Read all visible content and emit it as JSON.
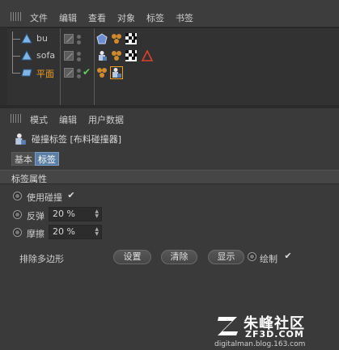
{
  "menubar": {
    "items": [
      "文件",
      "编辑",
      "查看",
      "对象",
      "标签",
      "书签"
    ]
  },
  "objects": [
    {
      "name": "bu",
      "icon": "mesh-icon",
      "selected": false,
      "tags": [
        "phong-tag-icon",
        "material-tag-icon",
        "texture-tag-icon"
      ],
      "extra": "compact-tag-icon"
    },
    {
      "name": "sofa",
      "icon": "mesh-icon",
      "selected": false,
      "tags": [
        "cloth-tag-icon",
        "material-tag-icon",
        "texture-tag-icon",
        "warning-icon"
      ],
      "extra": ""
    },
    {
      "name": "平面",
      "icon": "plane-icon",
      "selected": true,
      "tags": [
        "material-tag-icon",
        "collider-tag-icon"
      ],
      "extra": ""
    }
  ],
  "attributes": {
    "menu": [
      "模式",
      "编辑",
      "用户数据"
    ],
    "object_label": "碰撞标签 [布料碰撞器]",
    "tabs": [
      {
        "label": "基本",
        "active": false
      },
      {
        "label": "标签",
        "active": true
      }
    ],
    "section_title": "标签属性",
    "use_collision": {
      "label": "使用碰撞",
      "checked": true
    },
    "bounce": {
      "label": "反弹",
      "value": "20 %"
    },
    "friction": {
      "label": "摩擦",
      "value": "20 %"
    },
    "exclude": {
      "label": "排除多边形",
      "set_button": "设置",
      "clear_button": "清除",
      "show_button": "显示",
      "draw_label": "绘制",
      "draw_checked": true
    },
    "check_mark": "✔"
  },
  "colors": {
    "accent_tab": "#5b7fa4",
    "selected_object": "#f0a01c",
    "background": "#3a3a3a"
  },
  "watermark": {
    "cn": "朱峰社区",
    "site": "ZF3D.COM",
    "url": "digitalman.blog.163.com"
  }
}
